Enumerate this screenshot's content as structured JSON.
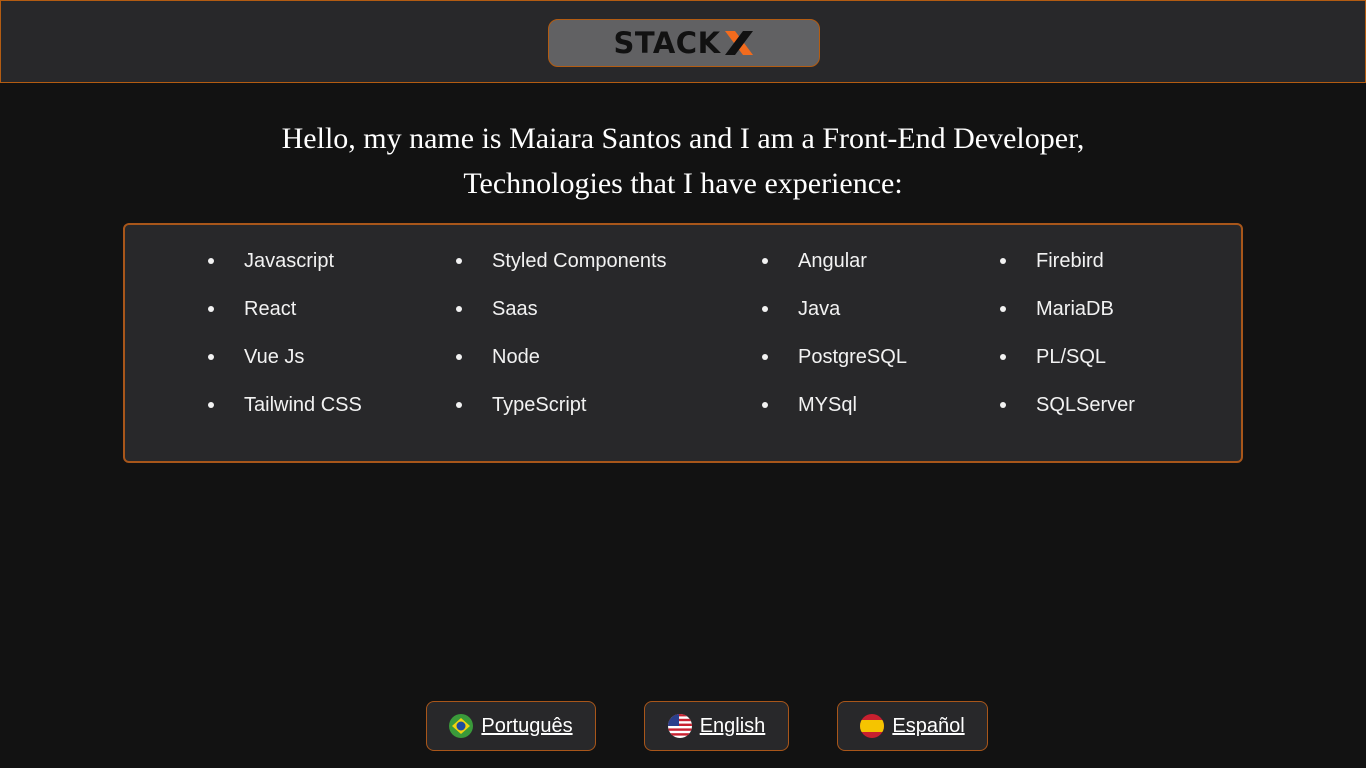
{
  "header": {
    "logo_text": "STACK",
    "logo_accent_color": "#f26b1d"
  },
  "intro": {
    "line1": "Hello, my name is Maiara Santos and I am a Front-End Developer,",
    "line2": "Technologies that I have experience:"
  },
  "technologies": {
    "col1": [
      "Javascript",
      "React",
      "Vue Js",
      "Tailwind CSS"
    ],
    "col2": [
      "Styled Components",
      "Saas",
      "Node",
      "TypeScript"
    ],
    "col3": [
      "Angular",
      "Java",
      "PostgreSQL",
      "MYSql"
    ],
    "col4": [
      "Firebird",
      "MariaDB",
      "PL/SQL",
      "SQLServer"
    ]
  },
  "languages": [
    {
      "label": "Português",
      "icon": "brazil-flag-icon"
    },
    {
      "label": "English",
      "icon": "usa-flag-icon"
    },
    {
      "label": "Español",
      "icon": "spain-flag-icon"
    }
  ],
  "colors": {
    "accent_border": "#b35c12",
    "background": "#121212",
    "panel": "#28282a"
  }
}
